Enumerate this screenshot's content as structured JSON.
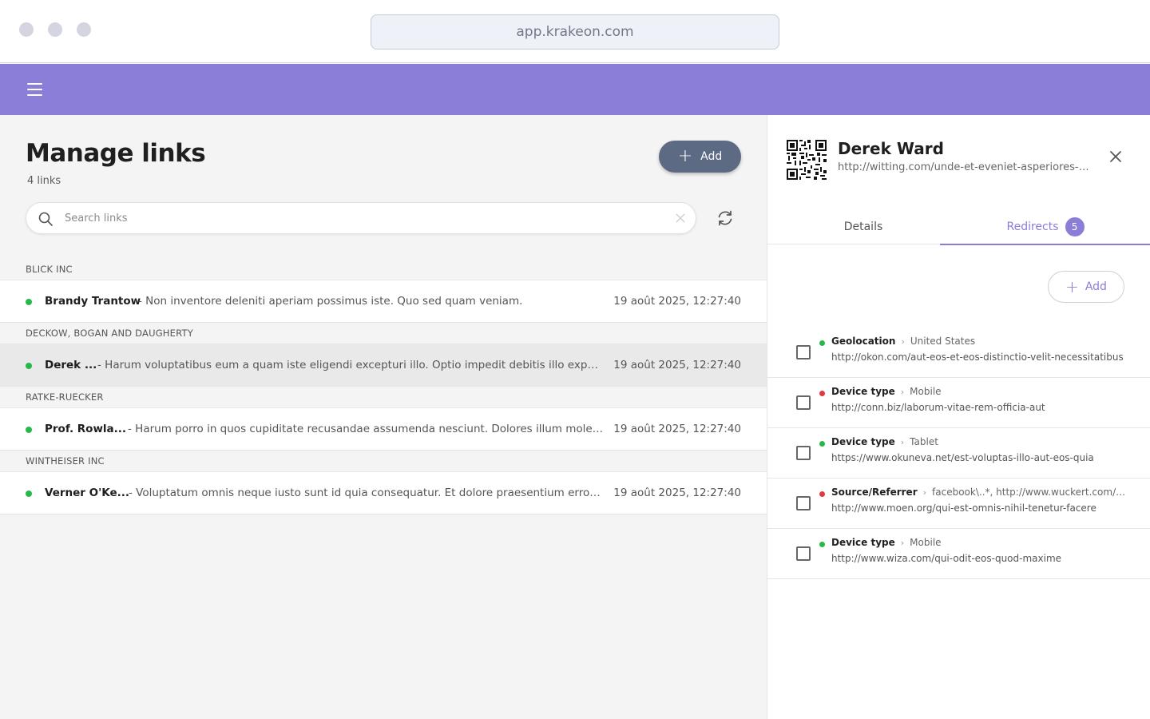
{
  "browser": {
    "url": "app.krakeon.com"
  },
  "page": {
    "title": "Manage links",
    "count": "4 links",
    "add_label": "Add",
    "search_placeholder": "Search links",
    "search_value": ""
  },
  "groups": [
    {
      "name": "BLICK INC",
      "rows": [
        {
          "name": "Brandy Trantow",
          "desc": "- Non inventore deleniti aperiam possimus iste. Quo sed quam veniam.",
          "date": "19 août 2025, 12:27:40",
          "status": "active"
        }
      ]
    },
    {
      "name": "DECKOW, BOGAN AND DAUGHERTY",
      "rows": [
        {
          "name": "Derek ...",
          "desc": "- Harum voluptatibus eum a quam iste eligendi excepturi illo. Optio impedit debitis illo expedita.",
          "date": "19 août 2025, 12:27:40",
          "status": "active",
          "selected": true
        }
      ]
    },
    {
      "name": "RATKE-RUECKER",
      "rows": [
        {
          "name": "Prof. Rowla...",
          "desc": "- Harum porro in quos cupiditate recusandae assumenda nesciunt. Dolores illum molestias.",
          "date": "19 août 2025, 12:27:40",
          "status": "active"
        }
      ]
    },
    {
      "name": "WINTHEISER INC",
      "rows": [
        {
          "name": "Verner O'Ke...",
          "desc": "- Voluptatum omnis neque iusto sunt id quia consequatur. Et dolore praesentium error voluptas.",
          "date": "19 août 2025, 12:27:40",
          "status": "active"
        }
      ]
    }
  ],
  "detail": {
    "name": "Derek Ward",
    "url": "http://witting.com/unde-et-eveniet-asperiores-blanditiis",
    "tabs": [
      {
        "label": "Details"
      },
      {
        "label": "Redirects",
        "badge": "5"
      }
    ],
    "add_label": "Add",
    "redirects": [
      {
        "type": "Geolocation",
        "value": "United States",
        "url": "http://okon.com/aut-eos-et-eos-distinctio-velit-necessitatibus",
        "status_color": "#28b84a"
      },
      {
        "type": "Device type",
        "value": "Mobile",
        "url": "http://conn.biz/laborum-vitae-rem-officia-aut",
        "status_color": "#e0393e"
      },
      {
        "type": "Device type",
        "value": "Tablet",
        "url": "https://www.okuneva.net/est-voluptas-illo-aut-eos-quia",
        "status_color": "#28b84a"
      },
      {
        "type": "Source/Referrer",
        "value": "facebook\\..*, http://www.wuckert.com/vel-voluptatem",
        "url": "http://www.moen.org/qui-est-omnis-nihil-tenetur-facere",
        "status_color": "#e0393e"
      },
      {
        "type": "Device type",
        "value": "Mobile",
        "url": "http://www.wiza.com/qui-odit-eos-quod-maxime",
        "status_color": "#28b84a"
      }
    ]
  },
  "colors": {
    "brand": "#8a7ed9",
    "primary_button": "#5d6a83",
    "status_green": "#28b84a",
    "status_red": "#e0393e"
  }
}
